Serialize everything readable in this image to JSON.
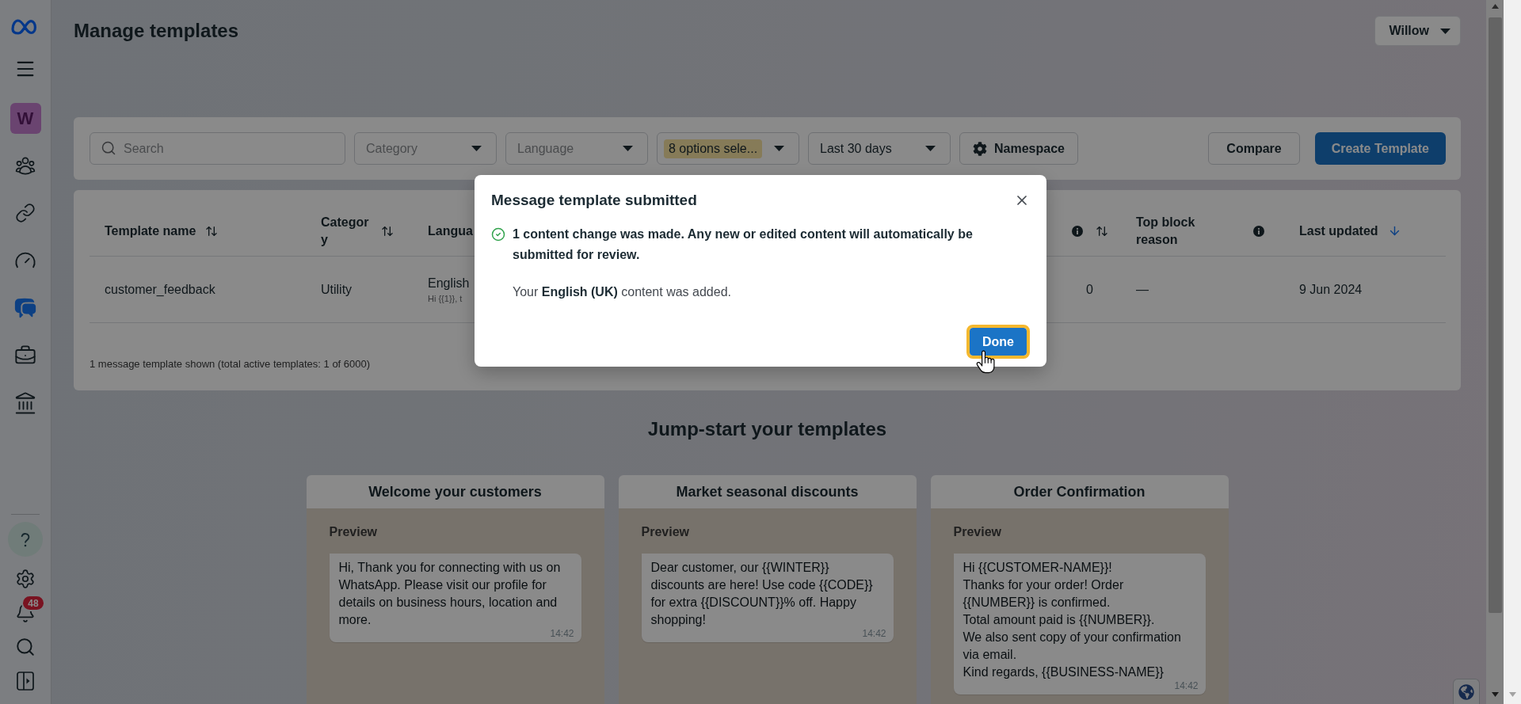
{
  "sidebar": {
    "workspace_avatar": "W",
    "nav": [
      {
        "selected": false
      },
      {
        "selected": false
      },
      {
        "selected": false
      },
      {
        "selected": true
      },
      {
        "selected": false
      },
      {
        "selected": false
      }
    ],
    "notification_count": "48"
  },
  "header": {
    "title": "Manage templates",
    "account_menu": "Willow"
  },
  "filters": {
    "search": {
      "placeholder": "Search"
    },
    "dropdowns": [
      {
        "placeholder": "Category",
        "highlighted": false
      },
      {
        "placeholder": "Language",
        "highlighted": false
      },
      {
        "value": "8 options sele...",
        "highlighted": true
      },
      {
        "value": "Last 30 days",
        "highlighted": false
      }
    ],
    "namespace_button": "Namespace",
    "compare_button": "Compare",
    "create_button": "Create Template"
  },
  "table": {
    "columns": [
      {
        "label": "Template name",
        "info": false,
        "sort_toggle": true,
        "sorted_descending": false
      },
      {
        "label": "Category",
        "info": false,
        "sort_toggle": true,
        "sorted_descending": false
      },
      {
        "label": "Langua",
        "info": false,
        "sort_toggle": false,
        "sorted_descending": false
      },
      {
        "info": true,
        "sort_toggle": true,
        "sorted_descending": false
      },
      {
        "label": "Top block reason",
        "info": true,
        "sort_toggle": false,
        "sorted_descending": false
      },
      {
        "label": "Last updated",
        "info": false,
        "sort_toggle": false,
        "sorted_descending": true
      }
    ],
    "rows": [
      {
        "template_name": "customer_feedback",
        "category": "Utility",
        "language": "English",
        "language_preview": "Hi {{1}}, t",
        "column_4": "0",
        "top_block_reason": "—",
        "last_updated": "9 Jun 2024"
      }
    ],
    "summary": "1 message template shown (total active templates: 1 of 6000)"
  },
  "dialog": {
    "title": "Message template submitted",
    "message": "1 content change was made. Any new or edited content will automatically be submitted for review.",
    "detail": "Your **English (UK)** content was added.",
    "done_button": {
      "label": "Done",
      "focused": true
    }
  },
  "jump_start": {
    "title": "Jump-start your templates",
    "cards": [
      {
        "title": "Welcome your customers",
        "preview_label": "Preview",
        "message": "Hi, Thank you for connecting with us on\nWhatsApp. Please visit our profile for\ndetails on business hours, location and\nmore.",
        "time": "14:42"
      },
      {
        "title": "Market seasonal discounts",
        "preview_label": "Preview",
        "message": "Dear customer, our {{WINTER}}\ndiscounts are here! Use code {{CODE}}\nfor extra {{DISCOUNT}}% off. Happy\nshopping!",
        "time": "14:42"
      },
      {
        "title": "Order Confirmation",
        "preview_label": "Preview",
        "message": "Hi {{CUSTOMER-NAME}}!\nThanks for your order! Order\n{{NUMBER}} is confirmed.\nTotal amount paid is {{NUMBER}}.\nWe also sent copy of your confirmation\nvia email.\nKind regards, {{BUSINESS-NAME}}",
        "time": "14:42"
      }
    ]
  }
}
